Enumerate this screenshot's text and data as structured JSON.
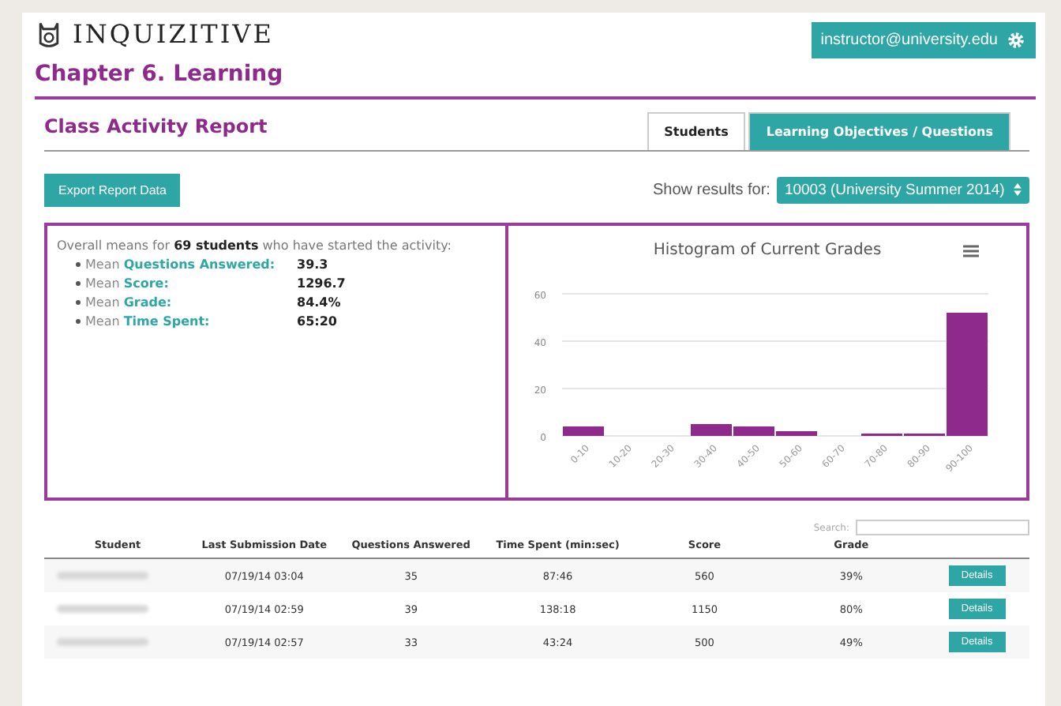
{
  "header": {
    "logo": "INQUIZITIVE",
    "chapter": "Chapter 6. Learning",
    "user": "instructor@university.edu"
  },
  "report": {
    "title": "Class Activity Report"
  },
  "tabs": [
    {
      "label": "Students",
      "selected": true
    },
    {
      "label": "Learning Objectives / Questions",
      "selected": false
    }
  ],
  "export_button": "Export Report Data",
  "filter": {
    "label": "Show results for:",
    "value": "10003 (University Summer 2014)"
  },
  "summary": {
    "intro": "Overall means for **69 students** who have started the activity:",
    "items": [
      {
        "prefix": "Mean",
        "label": "Questions Answered:",
        "value": "39.3"
      },
      {
        "prefix": "Mean",
        "label": "Score:",
        "value": "1296.7"
      },
      {
        "prefix": "Mean",
        "label": "Grade:",
        "value": "84.4%"
      },
      {
        "prefix": "Mean",
        "label": "Time Spent:",
        "value": "65:20"
      }
    ]
  },
  "chart": {
    "chart_data": {
      "type": "bar",
      "title": "Histogram of Current Grades",
      "categories": [
        "0-10",
        "10-20",
        "20-30",
        "30-40",
        "40-50",
        "50-60",
        "60-70",
        "70-80",
        "80-90",
        "90-100"
      ],
      "series": [
        {
          "color": "#8e2a8c",
          "values": [
            4,
            0,
            0,
            5,
            4,
            2,
            0,
            1,
            1,
            52
          ]
        }
      ],
      "ylim": [
        0,
        60
      ],
      "yticks": [
        0,
        20,
        40,
        60
      ]
    }
  },
  "table": {
    "search_label": "Search:",
    "columns": [
      "Student",
      "Last Submission Date",
      "Questions Answered",
      "Time Spent (min:sec)",
      "Score",
      "Grade"
    ],
    "rows": [
      {
        "date": "07/19/14 03:04",
        "answered": "35",
        "time": "87:46",
        "score": "560",
        "grade": "39%",
        "action": "Details"
      },
      {
        "date": "07/19/14 02:59",
        "answered": "39",
        "time": "138:18",
        "score": "1150",
        "grade": "80%",
        "action": "Details"
      },
      {
        "date": "07/19/14 02:57",
        "answered": "33",
        "time": "43:24",
        "score": "500",
        "grade": "49%",
        "action": "Details"
      }
    ]
  }
}
